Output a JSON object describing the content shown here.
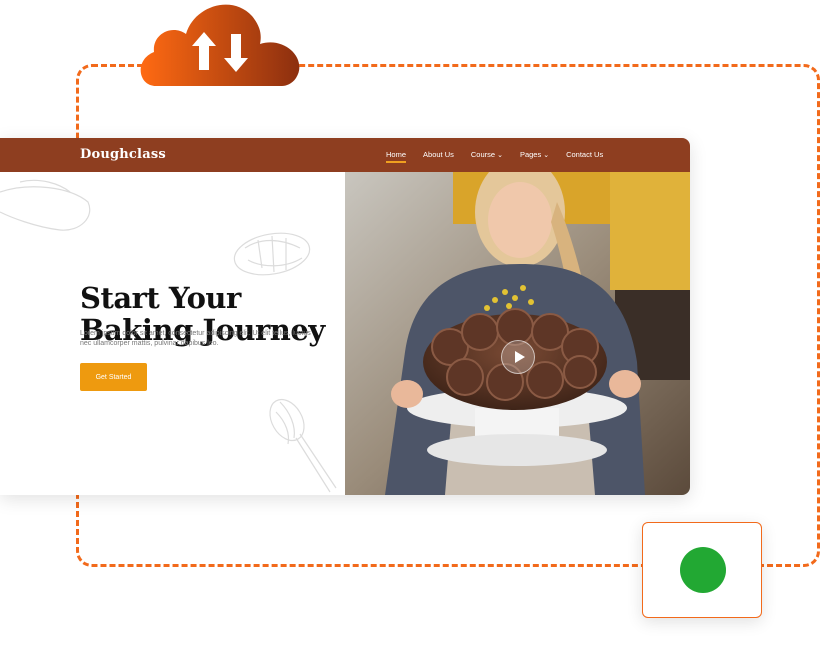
{
  "nav": {
    "logo": "Doughclass",
    "links": [
      {
        "label": "Home",
        "active": true
      },
      {
        "label": "About Us",
        "active": false
      },
      {
        "label": "Course",
        "dropdown": true
      },
      {
        "label": "Pages",
        "dropdown": true
      },
      {
        "label": "Contact Us",
        "active": false
      }
    ]
  },
  "hero": {
    "title_line1": "Start Your",
    "title_line2": "Baking Journey",
    "body": "Lorem ipsum dolor sit amet, consectetur adipiscing elit. Ut elit tellus, luctus nec ullamcorper mattis, pulvinar dapibus leo.",
    "cta_label": "Get Started"
  },
  "icons": {
    "cloud": "cloud-sync-icon",
    "play": "play-icon",
    "status": "green-status-dot"
  },
  "colors": {
    "accent_orange": "#f26a1b",
    "nav_brown": "#8e3e20",
    "cta_yellow": "#ee9a0f",
    "status_green": "#22a833"
  }
}
